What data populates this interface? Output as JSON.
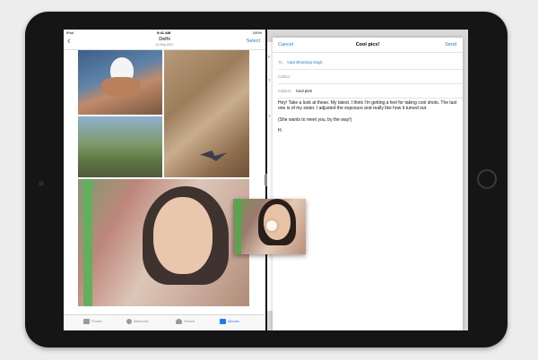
{
  "status_bar": {
    "carrier": "iPad",
    "time": "9:41 AM",
    "battery": "100%"
  },
  "photos": {
    "nav": {
      "back": "‹",
      "title": "Delhi",
      "subtitle": "10 Sep 2017",
      "select": "Select"
    },
    "tabs": [
      {
        "label": "Photos",
        "icon": "photos-icon",
        "active": false
      },
      {
        "label": "Memories",
        "icon": "memories-icon",
        "active": false
      },
      {
        "label": "Shared",
        "icon": "cloud-icon",
        "active": false
      },
      {
        "label": "Albums",
        "icon": "albums-icon",
        "active": true
      }
    ]
  },
  "mail": {
    "cancel": "Cancel",
    "title": "Cool pics!",
    "send": "Send",
    "to_label": "To:",
    "to_value": "Vipul Bhardwaj Singh",
    "cc_label": "Cc/Bcc:",
    "subject_label": "Subject:",
    "subject_value": "Cool pics!",
    "body": [
      "Hey! Take a look at these. My latest. I think I'm getting a feel for taking cool shots. The last one is of my sister. I adjusted the exposure and really like how it turned out.",
      "(She wants to meet you, by the way!)",
      "H."
    ]
  },
  "mail_edge_letters": [
    "F",
    "T",
    "T"
  ]
}
